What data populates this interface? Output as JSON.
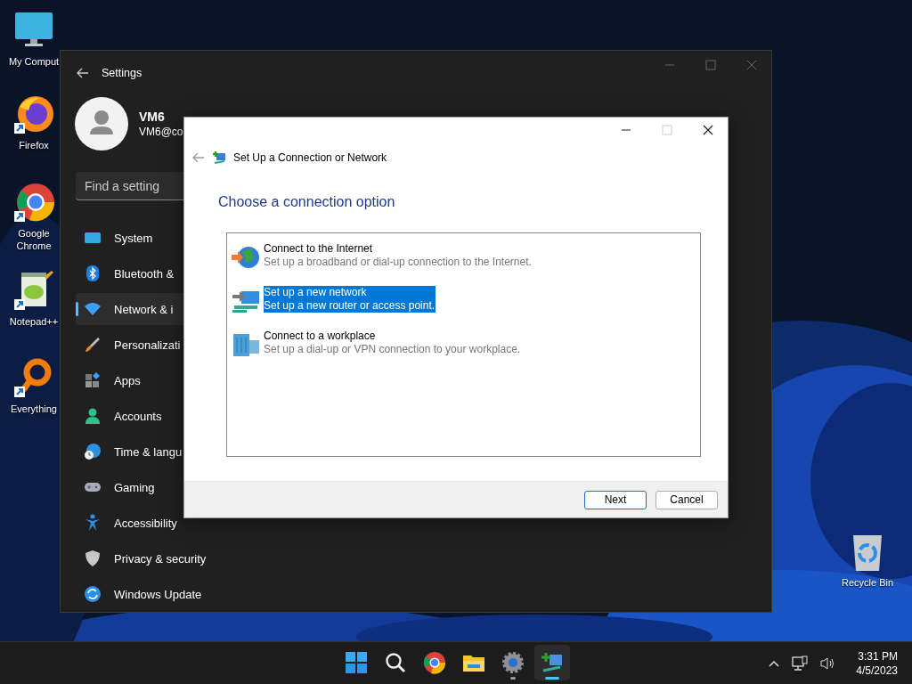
{
  "desktop_icons": [
    {
      "label": "My Comput"
    },
    {
      "label": "Firefox"
    },
    {
      "label": "Google Chrome"
    },
    {
      "label": "Notepad++"
    },
    {
      "label": "Everything"
    },
    {
      "label": "Recycle Bin"
    }
  ],
  "settings_window": {
    "title": "Settings",
    "user": {
      "name": "VM6",
      "email": "VM6@co"
    },
    "search": {
      "placeholder": "Find a setting"
    },
    "nav": [
      {
        "label": "System",
        "selected": false
      },
      {
        "label": "Bluetooth &",
        "selected": false
      },
      {
        "label": "Network & i",
        "selected": true
      },
      {
        "label": "Personalizati",
        "selected": false
      },
      {
        "label": "Apps",
        "selected": false
      },
      {
        "label": "Accounts",
        "selected": false
      },
      {
        "label": "Time & langu",
        "selected": false
      },
      {
        "label": "Gaming",
        "selected": false
      },
      {
        "label": "Accessibility",
        "selected": false
      },
      {
        "label": "Privacy & security",
        "selected": false
      },
      {
        "label": "Windows Update",
        "selected": false
      }
    ]
  },
  "dialog": {
    "title": "Set Up a Connection or Network",
    "heading": "Choose a connection option",
    "options": [
      {
        "title": "Connect to the Internet",
        "description": "Set up a broadband or dial-up connection to the Internet.",
        "selected": false
      },
      {
        "title": "Set up a new network",
        "description": "Set up a new router or access point.",
        "selected": true
      },
      {
        "title": "Connect to a workplace",
        "description": "Set up a dial-up or VPN connection to your workplace.",
        "selected": false
      }
    ],
    "buttons": [
      {
        "label": "Next",
        "default": true
      },
      {
        "label": "Cancel",
        "default": false
      }
    ]
  },
  "taskbar": {
    "apps": [
      {
        "running": false,
        "active": false
      },
      {
        "running": false,
        "active": false
      },
      {
        "running": false,
        "active": false
      },
      {
        "running": false,
        "active": false
      },
      {
        "running": true,
        "active": false
      },
      {
        "running": true,
        "active": true
      }
    ],
    "clock": {
      "time": "3:31 PM",
      "date": "4/5/2023"
    }
  }
}
